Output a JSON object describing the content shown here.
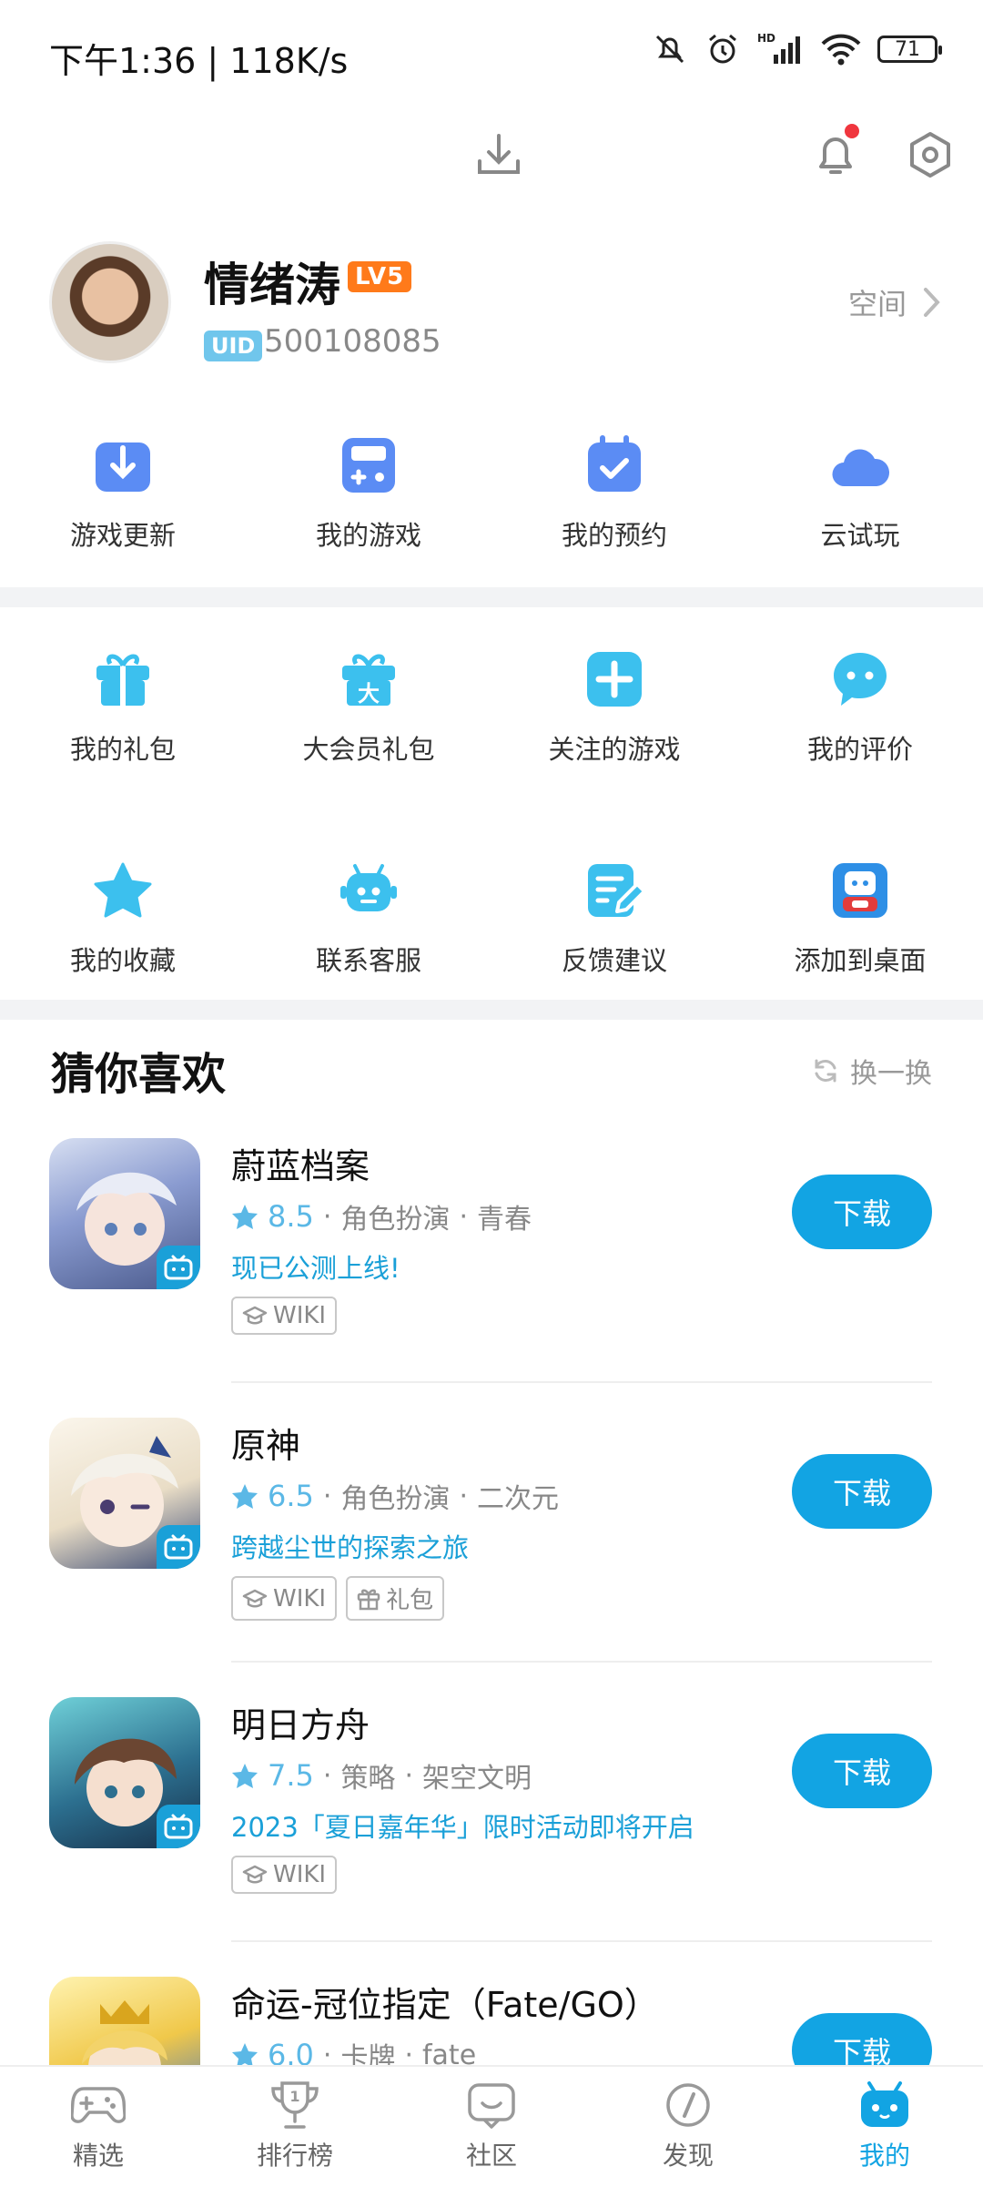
{
  "status_bar": {
    "time": "下午1:36 | 118K/s",
    "battery": "71"
  },
  "profile": {
    "username": "情绪涛",
    "level": "LV5",
    "uid_label": "UID",
    "uid": "500108085",
    "space_label": "空间"
  },
  "quick_actions": [
    {
      "label": "游戏更新",
      "icon": "download-box-icon"
    },
    {
      "label": "我的游戏",
      "icon": "gamepad-icon"
    },
    {
      "label": "我的预约",
      "icon": "calendar-check-icon"
    },
    {
      "label": "云试玩",
      "icon": "cloud-icon"
    }
  ],
  "services": [
    {
      "label": "我的礼包",
      "icon": "gift-icon"
    },
    {
      "label": "大会员礼包",
      "icon": "vip-gift-icon"
    },
    {
      "label": "关注的游戏",
      "icon": "plus-icon"
    },
    {
      "label": "我的评价",
      "icon": "chat-bubble-icon"
    },
    {
      "label": "我的收藏",
      "icon": "star-icon"
    },
    {
      "label": "联系客服",
      "icon": "service-robot-icon"
    },
    {
      "label": "反馈建议",
      "icon": "feedback-edit-icon"
    },
    {
      "label": "添加到桌面",
      "icon": "desktop-mascot-icon"
    }
  ],
  "recommend": {
    "title": "猜你喜欢",
    "refresh_label": "换一换",
    "games": [
      {
        "name": "蔚蓝档案",
        "score": "8.5",
        "cat1": "角色扮演",
        "cat2": "青春",
        "desc": "现已公测上线!",
        "tags": [
          {
            "label": "WIKI",
            "icon": "cap-icon"
          }
        ],
        "button": "下载",
        "color": "#8a9bd0"
      },
      {
        "name": "原神",
        "score": "6.5",
        "cat1": "角色扮演",
        "cat2": "二次元",
        "desc": "跨越尘世的探索之旅",
        "tags": [
          {
            "label": "WIKI",
            "icon": "cap-icon"
          },
          {
            "label": "礼包",
            "icon": "gift-icon"
          }
        ],
        "button": "下载",
        "color": "#e9ddc6"
      },
      {
        "name": "明日方舟",
        "score": "7.5",
        "cat1": "策略",
        "cat2": "架空文明",
        "desc": "2023「夏日嘉年华」限时活动即将开启",
        "tags": [
          {
            "label": "WIKI",
            "icon": "cap-icon"
          }
        ],
        "button": "下载",
        "color": "#2c6f8f"
      },
      {
        "name": "命运-冠位指定（Fate/GO）",
        "score": "6.0",
        "cat1": "卡牌",
        "cat2": "fate",
        "desc": "",
        "tags": [],
        "button": "下载",
        "color": "#f0c84a"
      }
    ]
  },
  "tabs": [
    {
      "label": "精选",
      "icon": "gamepad-tab-icon"
    },
    {
      "label": "排行榜",
      "icon": "trophy-icon"
    },
    {
      "label": "社区",
      "icon": "community-icon"
    },
    {
      "label": "发现",
      "icon": "compass-icon"
    },
    {
      "label": "我的",
      "icon": "mascot-tab-icon"
    }
  ],
  "colors": {
    "accent": "#12a4e3",
    "icon_blue": "#5b8cf4",
    "icon_cyan": "#3cc0ee",
    "level": "#ff7a1a"
  }
}
